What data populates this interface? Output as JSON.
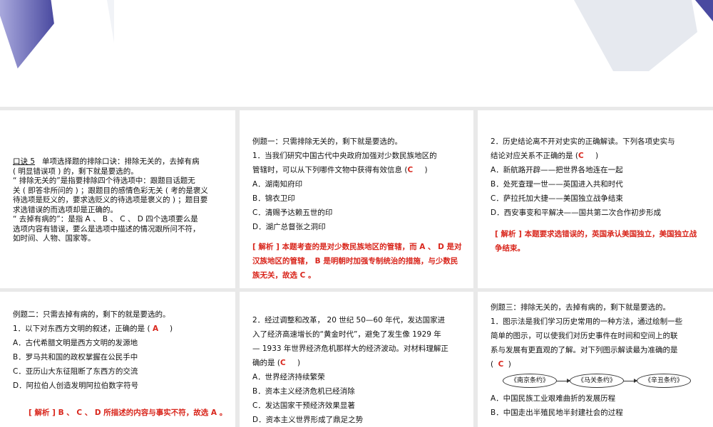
{
  "colors": {
    "answer": "#d9261c",
    "band": "#e9e9e9",
    "deco_left": "#7f7fc4",
    "deco_right": "#e3e7ee"
  },
  "p1": {
    "label": "口诀 5",
    "lines": [
      "单项选择题的排除口诀：排除无关的，去掉有病",
      "( 明显错误项 ) 的，剩下就是要选的。",
      "“ 排除无关的”是指要排除四个待选项中：跟题目话题无",
      "关 ( 即答非所问的 ) ；跟题目的感情色彩无关 ( 考的是褒义",
      "待选项是贬义的，要求选贬义的待选项是褒义的 ) ；题目要",
      "求选错误的而选项却是正确的。",
      "“ 去掉有病的”：是指 A 、 B 、 C 、 D 四个选项要么是",
      "选项内容有错误，要么是选项中描述的情况跟所问不符，",
      "如时间、人物、国家等。"
    ]
  },
  "p2": {
    "heading": "例题一：只需排除无关的，剩下就是要选的。",
    "q1": "1．当我们研究中国古代中央政府加强对少数民族地区的",
    "q2": "管辖时，可以从下列哪件文物中获得有效信息 (",
    "answer": "C",
    "close": ")",
    "options": [
      "A．湖南知府印",
      "B．锦衣卫印",
      "C．清赐予达赖五世的印",
      "D．湖广总督张之洞印"
    ],
    "note": "[ 解析 ] 本题考查的是对少数民族地区的管辖，而 A 、 D 是对汉族地区的管辖， B 是明朝时加强专制统治的措施，与少数民族无关，故选 C 。"
  },
  "p3": {
    "q1": "2．历史结论离不开对史实的正确解读。下列各项史实与",
    "q2": "结论对应关系不正确的是 (",
    "answer": "C",
    "close": ")",
    "options": [
      "A．新航路开辟——把世界各地连在一起",
      "B．处死查理一世——英国进入共和时代",
      "C．萨拉托加大捷——美国独立战争结束",
      "D．西安事变和平解决——国共第二次合作初步形成"
    ],
    "note": "[ 解析 ] 本题要求选错误的，英国承认美国独立，美国独立战争结束。"
  },
  "p4": {
    "heading": "例题二：只需去掉有病的，剩下的就是要选的。",
    "q1": "1．以下对东西方文明的叙述，正确的是 (",
    "answer": "A",
    "close": ")",
    "options": [
      "A．古代希腊文明是西方文明的发源地",
      "B．罗马共和国的政权掌握在公民手中",
      "C．亚历山大东征阻断了东西方的交流",
      "D．阿拉伯人创造发明阿拉伯数字符号"
    ],
    "note": "[ 解析 ] B 、 C 、 D 所描述的内容与事实不符，故选 A 。"
  },
  "p5": {
    "lines": [
      "2．经过调整和改革， 20 世纪 50—60 年代，发达国家进",
      "入了经济高速增长的“黄金时代”，避免了发生像 1929 年",
      "— 1933 年世界经济危机那样大的经济波动。对材料理解正"
    ],
    "q_last": "确的是 (",
    "answer": "C",
    "close": ")",
    "options": [
      "A．世界经济持续繁荣",
      "B．资本主义经济危机已经消除",
      "C．发达国家干预经济效果显著",
      "D．资本主义世界形成了鼎足之势"
    ]
  },
  "p6": {
    "heading": "例题三：排除无关的，去掉有病的，剩下就是要选的。",
    "lines": [
      "1．图示法是我们学习历史常用的一种方法，通过绘制一些",
      "简单的图示，可以使我们对历史事件在时间和空间上的联",
      "系与发展有更直观的了解。对下列图示解读最为准确的是"
    ],
    "open": "(",
    "answer": "C",
    "close": ")",
    "diagram": [
      "《南京条约》",
      "《马关条约》",
      "《辛丑条约》"
    ],
    "options": [
      "A．中国民族工业艰难曲折的发展历程",
      "B．中国走出半殖民地半封建社会的过程"
    ]
  }
}
